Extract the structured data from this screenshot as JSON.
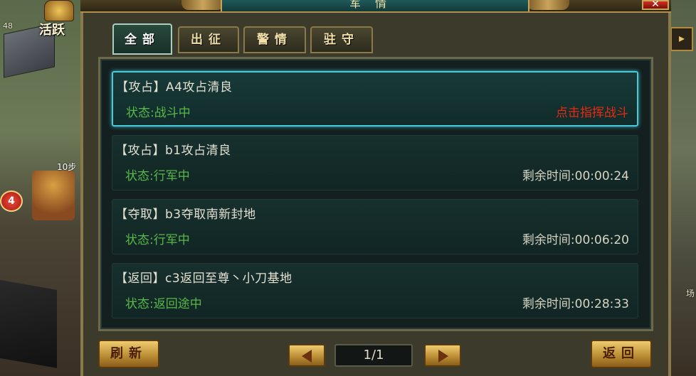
{
  "hud": {
    "activity_label": "活跃",
    "level_value": "48",
    "notification_count": "4",
    "steps_label": "10步",
    "right_label": "场"
  },
  "window": {
    "title": "军情",
    "close_symbol": "✕"
  },
  "tabs": [
    {
      "label": "全部",
      "active": true
    },
    {
      "label": "出征",
      "active": false
    },
    {
      "label": "警情",
      "active": false
    },
    {
      "label": "驻守",
      "active": false
    }
  ],
  "rows": [
    {
      "title": "【攻占】A4攻占清良",
      "status": "状态:战斗中",
      "right_text": "点击指挥战斗",
      "alert": true
    },
    {
      "title": "【攻占】b1攻占清良",
      "status": "状态:行军中",
      "right_text": "剩余时间:00:00:24",
      "alert": false
    },
    {
      "title": "【夺取】b3夺取南新封地",
      "status": "状态:行军中",
      "right_text": "剩余时间:00:06:20",
      "alert": false
    },
    {
      "title": "【返回】c3返回至尊丶小刀基地",
      "status": "状态:返回途中",
      "right_text": "剩余时间:00:28:33",
      "alert": false
    }
  ],
  "footer": {
    "refresh_label": "刷新",
    "page_indicator": "1/1",
    "back_label": "返回"
  },
  "colors": {
    "status_green": "#58b84a",
    "alert_red": "#e82a12",
    "selected_border": "#4cc8d8"
  }
}
